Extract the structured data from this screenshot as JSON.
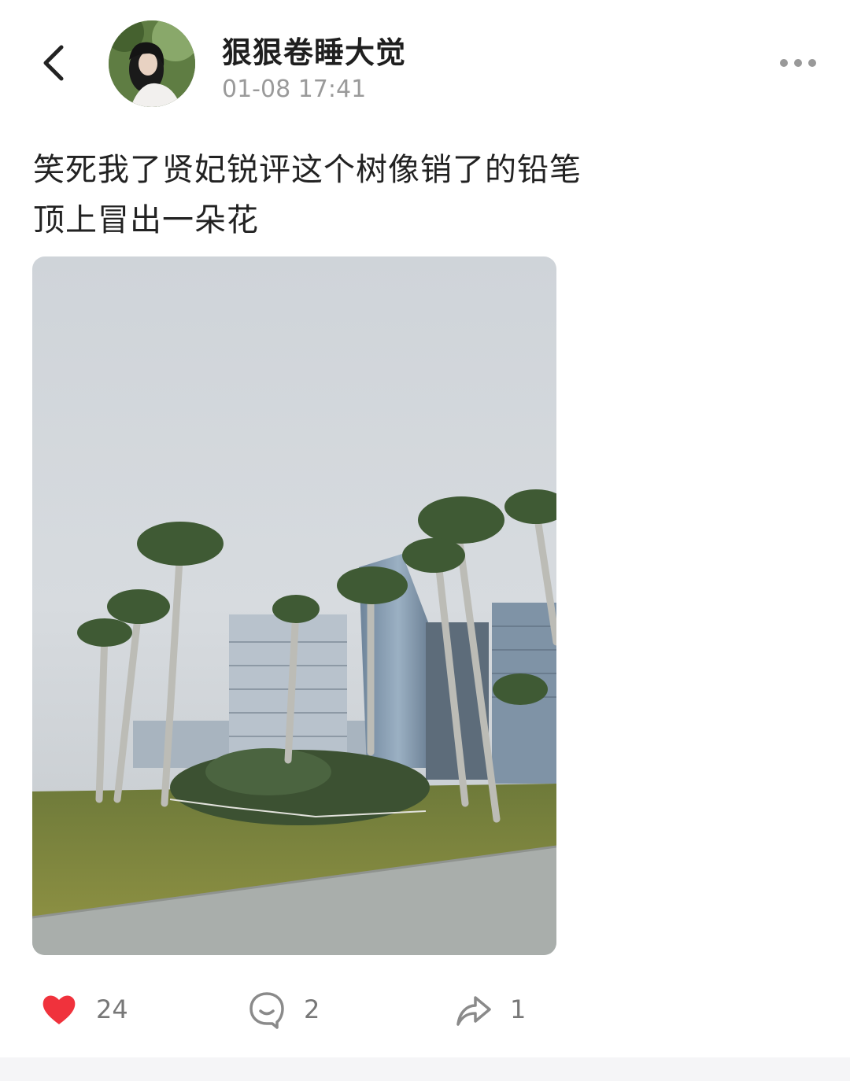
{
  "header": {
    "username": "狠狠卷睡大觉",
    "timestamp": "01-08 17:41"
  },
  "post": {
    "text_lines": [
      "笑死我了贤妃锐评这个树像销了的铅笔",
      "顶上冒出一朵花"
    ]
  },
  "actions": {
    "like_count": "24",
    "comment_count": "2",
    "share_count": "1"
  },
  "colors": {
    "like_red": "#f0323c",
    "icon_gray": "#8a8a8a",
    "timestamp_gray": "#9a9a9a"
  },
  "icons": [
    "back-arrow-icon",
    "more-dots-icon",
    "heart-icon",
    "comment-icon",
    "share-icon"
  ]
}
